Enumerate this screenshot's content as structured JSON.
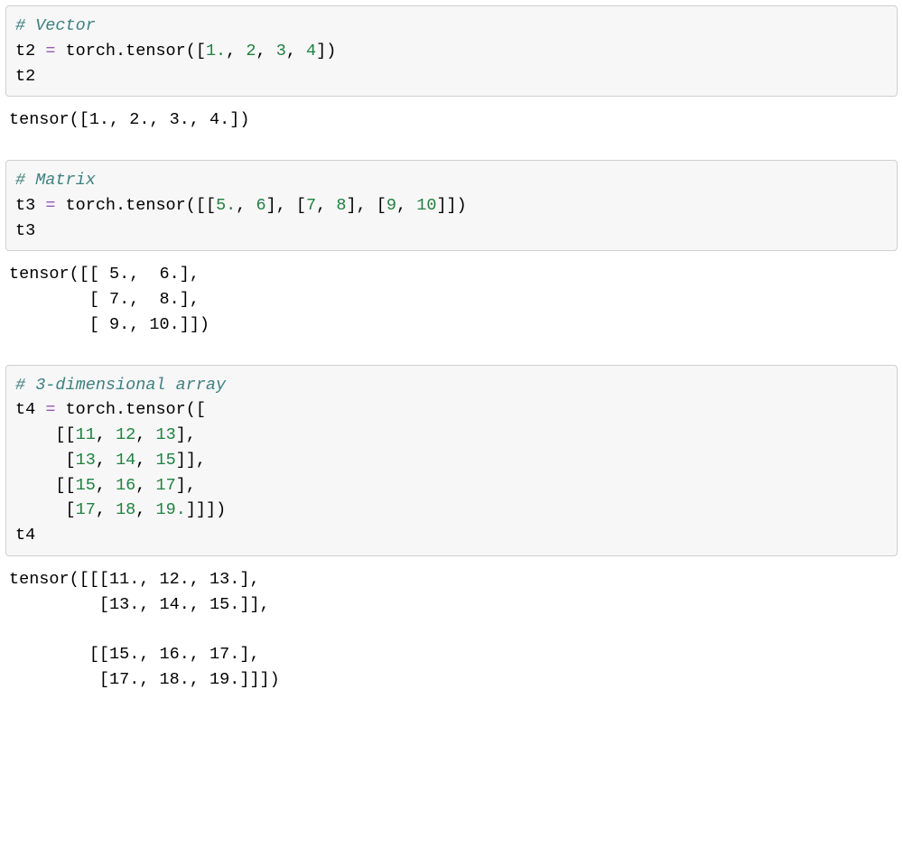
{
  "cells": [
    {
      "input": [
        {
          "type": "comment",
          "text": "# Vector"
        },
        {
          "type": "newline"
        },
        {
          "type": "ident",
          "text": "t2 "
        },
        {
          "type": "op",
          "text": "="
        },
        {
          "type": "ident",
          "text": " torch.tensor(["
        },
        {
          "type": "num",
          "text": "1."
        },
        {
          "type": "punc",
          "text": ", "
        },
        {
          "type": "num",
          "text": "2"
        },
        {
          "type": "punc",
          "text": ", "
        },
        {
          "type": "num",
          "text": "3"
        },
        {
          "type": "punc",
          "text": ", "
        },
        {
          "type": "num",
          "text": "4"
        },
        {
          "type": "punc",
          "text": "])"
        },
        {
          "type": "newline"
        },
        {
          "type": "ident",
          "text": "t2"
        }
      ],
      "output": "tensor([1., 2., 3., 4.])"
    },
    {
      "input": [
        {
          "type": "comment",
          "text": "# Matrix"
        },
        {
          "type": "newline"
        },
        {
          "type": "ident",
          "text": "t3 "
        },
        {
          "type": "op",
          "text": "="
        },
        {
          "type": "ident",
          "text": " torch.tensor([["
        },
        {
          "type": "num",
          "text": "5."
        },
        {
          "type": "punc",
          "text": ", "
        },
        {
          "type": "num",
          "text": "6"
        },
        {
          "type": "punc",
          "text": "], ["
        },
        {
          "type": "num",
          "text": "7"
        },
        {
          "type": "punc",
          "text": ", "
        },
        {
          "type": "num",
          "text": "8"
        },
        {
          "type": "punc",
          "text": "], ["
        },
        {
          "type": "num",
          "text": "9"
        },
        {
          "type": "punc",
          "text": ", "
        },
        {
          "type": "num",
          "text": "10"
        },
        {
          "type": "punc",
          "text": "]])"
        },
        {
          "type": "newline"
        },
        {
          "type": "ident",
          "text": "t3"
        }
      ],
      "output": "tensor([[ 5.,  6.],\n        [ 7.,  8.],\n        [ 9., 10.]])"
    },
    {
      "input": [
        {
          "type": "comment",
          "text": "# 3-dimensional array"
        },
        {
          "type": "newline"
        },
        {
          "type": "ident",
          "text": "t4 "
        },
        {
          "type": "op",
          "text": "="
        },
        {
          "type": "ident",
          "text": " torch.tensor(["
        },
        {
          "type": "newline"
        },
        {
          "type": "ident",
          "text": "    [["
        },
        {
          "type": "num",
          "text": "11"
        },
        {
          "type": "punc",
          "text": ", "
        },
        {
          "type": "num",
          "text": "12"
        },
        {
          "type": "punc",
          "text": ", "
        },
        {
          "type": "num",
          "text": "13"
        },
        {
          "type": "punc",
          "text": "], "
        },
        {
          "type": "newline"
        },
        {
          "type": "ident",
          "text": "     ["
        },
        {
          "type": "num",
          "text": "13"
        },
        {
          "type": "punc",
          "text": ", "
        },
        {
          "type": "num",
          "text": "14"
        },
        {
          "type": "punc",
          "text": ", "
        },
        {
          "type": "num",
          "text": "15"
        },
        {
          "type": "punc",
          "text": "]], "
        },
        {
          "type": "newline"
        },
        {
          "type": "ident",
          "text": "    [["
        },
        {
          "type": "num",
          "text": "15"
        },
        {
          "type": "punc",
          "text": ", "
        },
        {
          "type": "num",
          "text": "16"
        },
        {
          "type": "punc",
          "text": ", "
        },
        {
          "type": "num",
          "text": "17"
        },
        {
          "type": "punc",
          "text": "], "
        },
        {
          "type": "newline"
        },
        {
          "type": "ident",
          "text": "     ["
        },
        {
          "type": "num",
          "text": "17"
        },
        {
          "type": "punc",
          "text": ", "
        },
        {
          "type": "num",
          "text": "18"
        },
        {
          "type": "punc",
          "text": ", "
        },
        {
          "type": "num",
          "text": "19."
        },
        {
          "type": "punc",
          "text": "]]])"
        },
        {
          "type": "newline"
        },
        {
          "type": "ident",
          "text": "t4"
        }
      ],
      "output": "tensor([[[11., 12., 13.],\n         [13., 14., 15.]],\n\n        [[15., 16., 17.],\n         [17., 18., 19.]]])"
    }
  ]
}
